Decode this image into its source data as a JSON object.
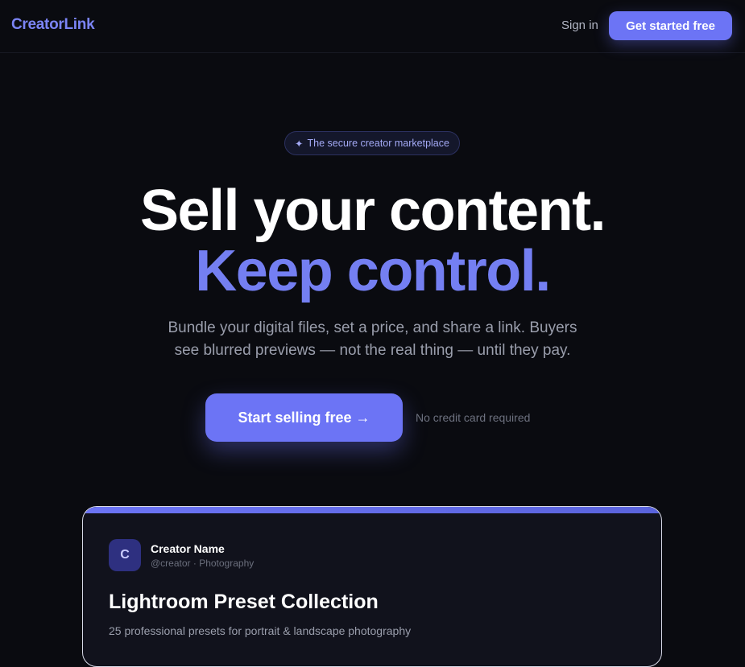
{
  "header": {
    "logo": "CreatorLink",
    "sign_in": "Sign in",
    "cta": "Get started free"
  },
  "hero": {
    "badge_icon": "✦",
    "badge_text": "The secure creator marketplace",
    "headline_1": "Sell your content.",
    "headline_2": "Keep control.",
    "subtext_1": "Bundle your digital files, set a price, and share a link. Buyers",
    "subtext_2": "see blurred previews — not the real thing — until they pay.",
    "cta": "Start selling free →",
    "note": "No credit card required"
  },
  "preview_card": {
    "avatar_letter": "C",
    "creator_name": "Creator Name",
    "creator_meta": "@creator · Photography",
    "product_title": "Lightroom Preset Collection",
    "product_desc": "25 professional presets for portrait & landscape photography"
  },
  "colors": {
    "background": "#0a0b10",
    "accent": "#6c74f5",
    "accent_text": "#747ff2"
  }
}
